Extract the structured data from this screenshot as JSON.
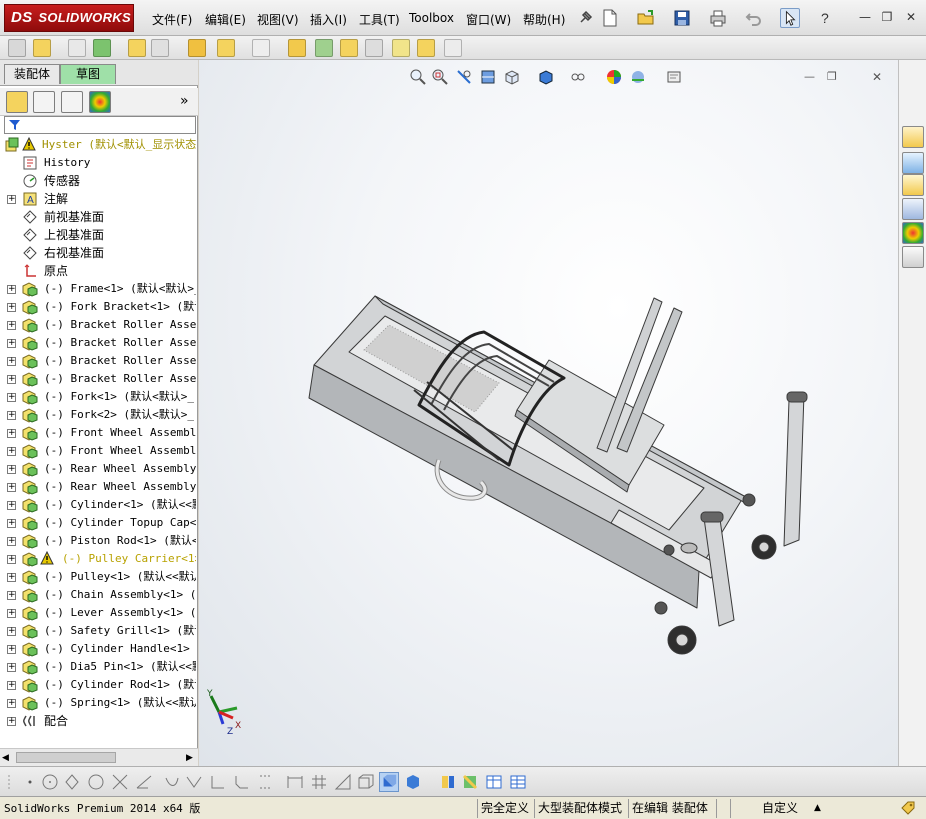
{
  "app": {
    "logo_text": "SOLIDWORKS",
    "logo_prefix": "DS"
  },
  "menu": {
    "items": [
      "文件(F)",
      "编辑(E)",
      "视图(V)",
      "插入(I)",
      "工具(T)",
      "Toolbox",
      "窗口(W)",
      "帮助(H)"
    ]
  },
  "window_controls": {
    "minimize": "—",
    "restore": "❐",
    "close": "✕",
    "doc_minimize": "—",
    "doc_restore": "❐",
    "doc_close": "✕"
  },
  "left_panel": {
    "tabs": [
      "装配体",
      "草图"
    ],
    "expand_glyph": "»",
    "tree": [
      {
        "label": "Hyster  (默认<默认_显示状态",
        "icon": "assembly-root-icon",
        "warning": true,
        "expander": false,
        "root": true
      },
      {
        "label": "History",
        "icon": "history-icon",
        "warning": false,
        "expander": false
      },
      {
        "label": "传感器",
        "icon": "sensor-icon",
        "warning": false,
        "expander": false,
        "cjk": true
      },
      {
        "label": "注解",
        "icon": "annotation-icon",
        "warning": false,
        "expander": true,
        "cjk": true
      },
      {
        "label": "前视基准面",
        "icon": "plane-icon",
        "warning": false,
        "expander": false,
        "cjk": true
      },
      {
        "label": "上视基准面",
        "icon": "plane-icon",
        "warning": false,
        "expander": false,
        "cjk": true
      },
      {
        "label": "右视基准面",
        "icon": "plane-icon",
        "warning": false,
        "expander": false,
        "cjk": true
      },
      {
        "label": "原点",
        "icon": "origin-icon",
        "warning": false,
        "expander": false,
        "cjk": true
      },
      {
        "label": "(-) Frame<1> (默认<默认>_",
        "icon": "component-icon",
        "warning": false,
        "expander": true
      },
      {
        "label": "(-) Fork Bracket<1> (默认<",
        "icon": "component-icon",
        "warning": false,
        "expander": true
      },
      {
        "label": "(-) Bracket Roller Assembl",
        "icon": "component-icon",
        "warning": false,
        "expander": true
      },
      {
        "label": "(-) Bracket Roller Assembl",
        "icon": "component-icon",
        "warning": false,
        "expander": true
      },
      {
        "label": "(-) Bracket Roller Assembl",
        "icon": "component-icon",
        "warning": false,
        "expander": true
      },
      {
        "label": "(-) Bracket Roller Assembl",
        "icon": "component-icon",
        "warning": false,
        "expander": true
      },
      {
        "label": "(-) Fork<1> (默认<默认>_",
        "icon": "component-icon",
        "warning": false,
        "expander": true
      },
      {
        "label": "(-) Fork<2> (默认<默认>_",
        "icon": "component-icon",
        "warning": false,
        "expander": true
      },
      {
        "label": "(-) Front Wheel Assembly<",
        "icon": "component-icon",
        "warning": false,
        "expander": true
      },
      {
        "label": "(-) Front Wheel Assembly<",
        "icon": "component-icon",
        "warning": false,
        "expander": true
      },
      {
        "label": "(-) Rear Wheel Assembly<1",
        "icon": "component-icon",
        "warning": false,
        "expander": true
      },
      {
        "label": "(-) Rear Wheel Assembly<2",
        "icon": "component-icon",
        "warning": false,
        "expander": true
      },
      {
        "label": "(-) Cylinder<1> (默认<<默",
        "icon": "component-icon",
        "warning": false,
        "expander": true
      },
      {
        "label": "(-) Cylinder Topup Cap<1>",
        "icon": "component-icon",
        "warning": false,
        "expander": true
      },
      {
        "label": "(-) Piston Rod<1> (默认<<",
        "icon": "component-icon",
        "warning": false,
        "expander": true
      },
      {
        "label": "(-) Pulley Carrier<1>",
        "icon": "component-icon",
        "warning": true,
        "expander": true
      },
      {
        "label": "(-) Pulley<1> (默认<<默认",
        "icon": "component-icon",
        "warning": false,
        "expander": true
      },
      {
        "label": "(-) Chain Assembly<1> (默",
        "icon": "component-icon",
        "warning": false,
        "expander": true
      },
      {
        "label": "(-) Lever Assembly<1> (默",
        "icon": "component-icon",
        "warning": false,
        "expander": true
      },
      {
        "label": "(-) Safety Grill<1> (默认",
        "icon": "component-icon",
        "warning": false,
        "expander": true
      },
      {
        "label": "(-) Cylinder Handle<1> (默",
        "icon": "component-icon",
        "warning": false,
        "expander": true
      },
      {
        "label": "(-) Dia5 Pin<1> (默认<<默",
        "icon": "component-icon",
        "warning": false,
        "expander": true
      },
      {
        "label": "(-) Cylinder Rod<1> (默认",
        "icon": "component-icon",
        "warning": false,
        "expander": true
      },
      {
        "label": "(-) Spring<1> (默认<<默认",
        "icon": "component-icon",
        "warning": false,
        "expander": true
      },
      {
        "label": "配合",
        "icon": "mates-icon",
        "warning": false,
        "expander": true,
        "cjk": true
      }
    ]
  },
  "triad": {
    "x": "X",
    "y": "Y",
    "z": "Z"
  },
  "statusbar": {
    "app_version": "SolidWorks Premium 2014 x64 版",
    "fully_defined": "完全定义",
    "large_assembly": "大型装配体模式",
    "editing": "在编辑 装配体",
    "units": "自定义",
    "units_arrow": "▲"
  },
  "colors": {
    "brand_red": "#c81e1e",
    "sketch_tab_green": "#9fe0a8",
    "warning_yellow": "#e6c800"
  }
}
